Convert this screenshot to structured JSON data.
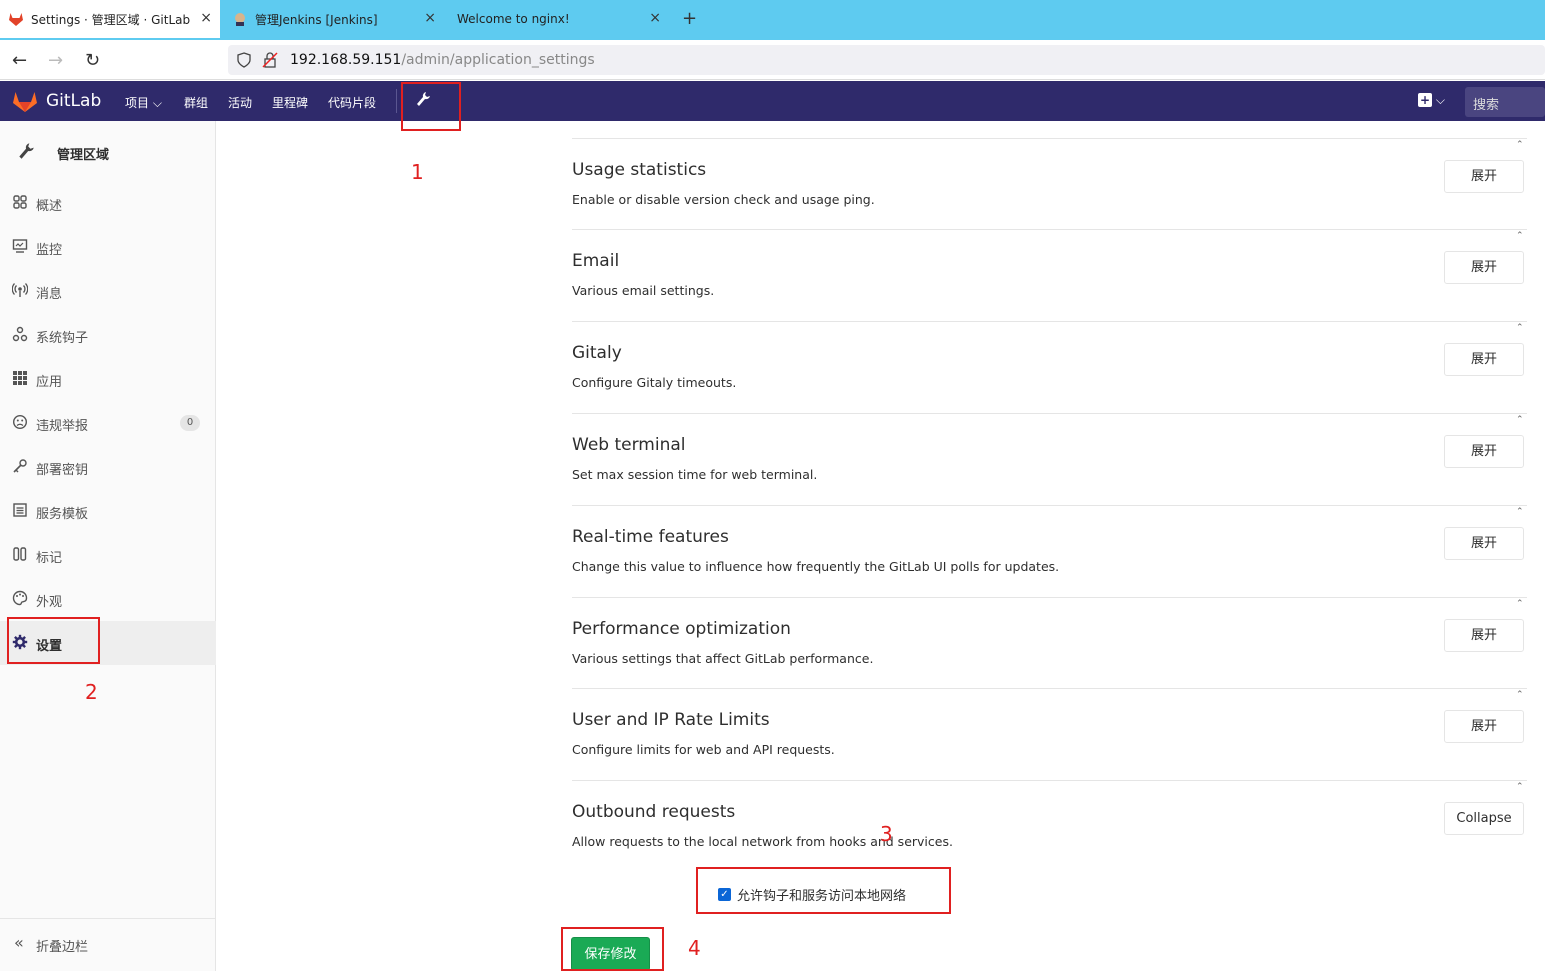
{
  "browser": {
    "tabs": [
      {
        "title": "Settings · 管理区域 · GitLab",
        "active": true
      },
      {
        "title": "管理Jenkins [Jenkins]",
        "active": false
      },
      {
        "title": "Welcome to nginx!",
        "active": false
      }
    ],
    "close_glyph": "×",
    "new_tab_glyph": "+",
    "url_host": "192.168.59.151",
    "url_path": "/admin/application_settings"
  },
  "header": {
    "logo_text": "GitLab",
    "nav": [
      "项目",
      "群组",
      "活动",
      "里程碑",
      "代码片段"
    ],
    "search_placeholder": "搜索",
    "brand_color": "#2f2a6b"
  },
  "sidebar": {
    "title": "管理区域",
    "items": [
      {
        "label": "概述",
        "icon": "overview-icon"
      },
      {
        "label": "监控",
        "icon": "monitor-icon"
      },
      {
        "label": "消息",
        "icon": "broadcast-icon"
      },
      {
        "label": "系统钩子",
        "icon": "hook-icon"
      },
      {
        "label": "应用",
        "icon": "apps-icon"
      },
      {
        "label": "违规举报",
        "icon": "abuse-icon",
        "badge": "0"
      },
      {
        "label": "部署密钥",
        "icon": "key-icon"
      },
      {
        "label": "服务模板",
        "icon": "template-icon"
      },
      {
        "label": "标记",
        "icon": "labels-icon"
      },
      {
        "label": "外观",
        "icon": "appearance-icon"
      },
      {
        "label": "设置",
        "icon": "gear-icon",
        "active": true
      }
    ],
    "collapse_label": "折叠边栏"
  },
  "sections": [
    {
      "title": "Usage statistics",
      "desc": "Enable or disable version check and usage ping.",
      "button": "展开"
    },
    {
      "title": "Email",
      "desc": "Various email settings.",
      "button": "展开"
    },
    {
      "title": "Gitaly",
      "desc": "Configure Gitaly timeouts.",
      "button": "展开"
    },
    {
      "title": "Web terminal",
      "desc": "Set max session time for web terminal.",
      "button": "展开"
    },
    {
      "title": "Real-time features",
      "desc": "Change this value to influence how frequently the GitLab UI polls for updates.",
      "button": "展开"
    },
    {
      "title": "Performance optimization",
      "desc": "Various settings that affect GitLab performance.",
      "button": "展开"
    },
    {
      "title": "User and IP Rate Limits",
      "desc": "Configure limits for web and API requests.",
      "button": "展开"
    },
    {
      "title": "Outbound requests",
      "desc": "Allow requests to the local network from hooks and services.",
      "button": "Collapse"
    }
  ],
  "outbound": {
    "checkbox_label": "允许钩子和服务访问本地网络",
    "checked": true
  },
  "save_label": "保存修改",
  "save_color": "#1aaa55",
  "annotations": [
    "1",
    "2",
    "3",
    "4"
  ],
  "annotation_color": "#e02020"
}
